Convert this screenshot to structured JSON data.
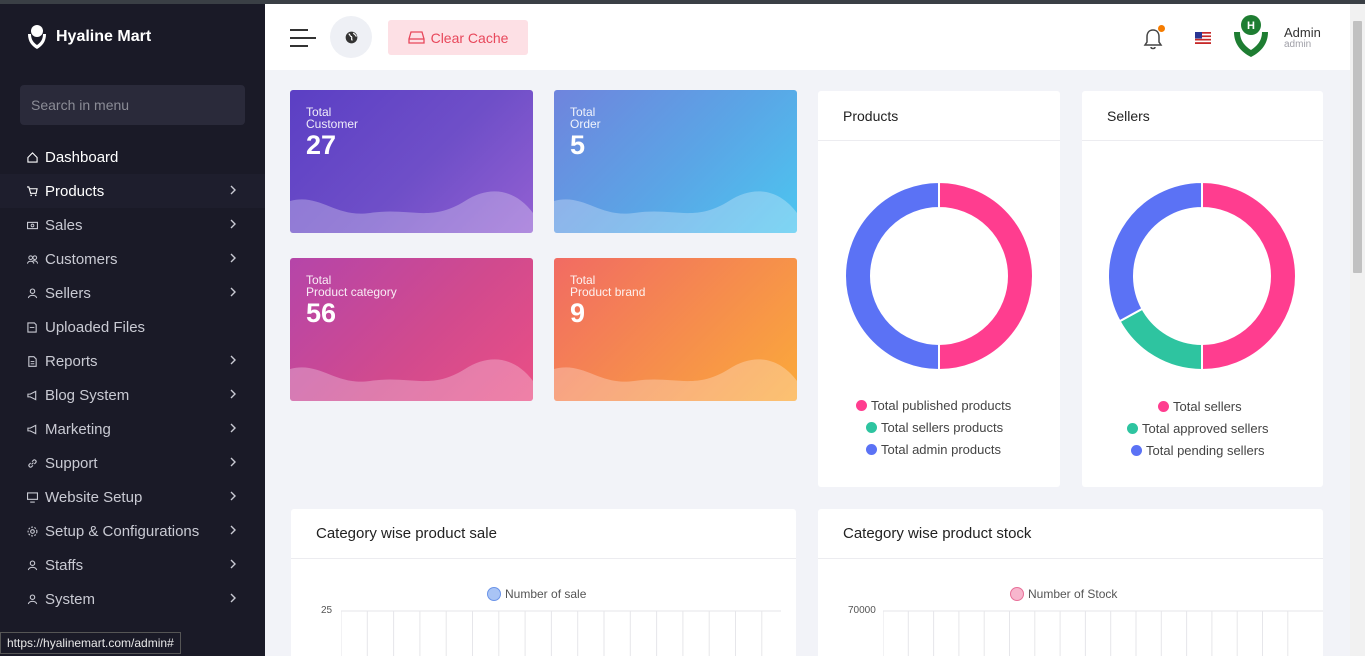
{
  "app": {
    "name": "Hyaline Mart"
  },
  "sidebar": {
    "search_placeholder": "Search in menu",
    "items": [
      {
        "label": "Dashboard",
        "icon": "home-icon",
        "chevron": false
      },
      {
        "label": "Products",
        "icon": "cart-icon",
        "chevron": true
      },
      {
        "label": "Sales",
        "icon": "money-icon",
        "chevron": true
      },
      {
        "label": "Customers",
        "icon": "users-icon",
        "chevron": true
      },
      {
        "label": "Sellers",
        "icon": "user-icon",
        "chevron": true
      },
      {
        "label": "Uploaded Files",
        "icon": "folder-icon",
        "chevron": false
      },
      {
        "label": "Reports",
        "icon": "file-icon",
        "chevron": true
      },
      {
        "label": "Blog System",
        "icon": "megaphone-icon",
        "chevron": true
      },
      {
        "label": "Marketing",
        "icon": "megaphone-icon",
        "chevron": true
      },
      {
        "label": "Support",
        "icon": "link-icon",
        "chevron": true
      },
      {
        "label": "Website Setup",
        "icon": "desktop-icon",
        "chevron": true
      },
      {
        "label": "Setup & Configurations",
        "icon": "gear-icon",
        "chevron": true
      },
      {
        "label": "Staffs",
        "icon": "user-icon",
        "chevron": true
      },
      {
        "label": "System",
        "icon": "user-icon",
        "chevron": true
      }
    ]
  },
  "status_url": "https://hyalinemart.com/admin#",
  "header": {
    "clear_cache_label": "Clear Cache",
    "admin_name": "Admin",
    "admin_role": "admin",
    "avatar_letter": "H"
  },
  "stats": [
    {
      "line1": "Total",
      "line2": "Customer",
      "value": "27"
    },
    {
      "line1": "Total",
      "line2": "Order",
      "value": "5"
    },
    {
      "line1": "Total",
      "line2": "Product category",
      "value": "56"
    },
    {
      "line1": "Total",
      "line2": "Product brand",
      "value": "9"
    }
  ],
  "colors": {
    "pink": "#ff3d8f",
    "teal": "#2ec4a0",
    "blue": "#5b72f5"
  },
  "products_panel": {
    "title": "Products",
    "legend": [
      "Total published products",
      "Total sellers products",
      "Total admin products"
    ]
  },
  "sellers_panel": {
    "title": "Sellers",
    "legend": [
      "Total sellers",
      "Total approved sellers",
      "Total pending sellers"
    ]
  },
  "chart_data": [
    {
      "type": "pie",
      "title": "Products",
      "labels": [
        "Total published products",
        "Total sellers products",
        "Total admin products"
      ],
      "values": [
        50,
        0,
        50
      ]
    },
    {
      "type": "pie",
      "title": "Sellers",
      "labels": [
        "Total sellers",
        "Total approved sellers",
        "Total pending sellers"
      ],
      "values": [
        50,
        17,
        33
      ]
    },
    {
      "type": "bar",
      "title": "Category wise product sale",
      "series": [
        {
          "name": "Number of sale",
          "values": []
        }
      ],
      "ylim": [
        0,
        25
      ],
      "yticks": [
        "25"
      ]
    },
    {
      "type": "bar",
      "title": "Category wise product stock",
      "series": [
        {
          "name": "Number of Stock",
          "values": []
        }
      ],
      "ylim": [
        0,
        70000
      ],
      "yticks": [
        "70000"
      ]
    }
  ],
  "sale_chart": {
    "title": "Category wise product sale",
    "legend": "Number of sale",
    "ytick": "25"
  },
  "stock_chart": {
    "title": "Category wise product stock",
    "legend": "Number of Stock",
    "ytick": "70000"
  }
}
